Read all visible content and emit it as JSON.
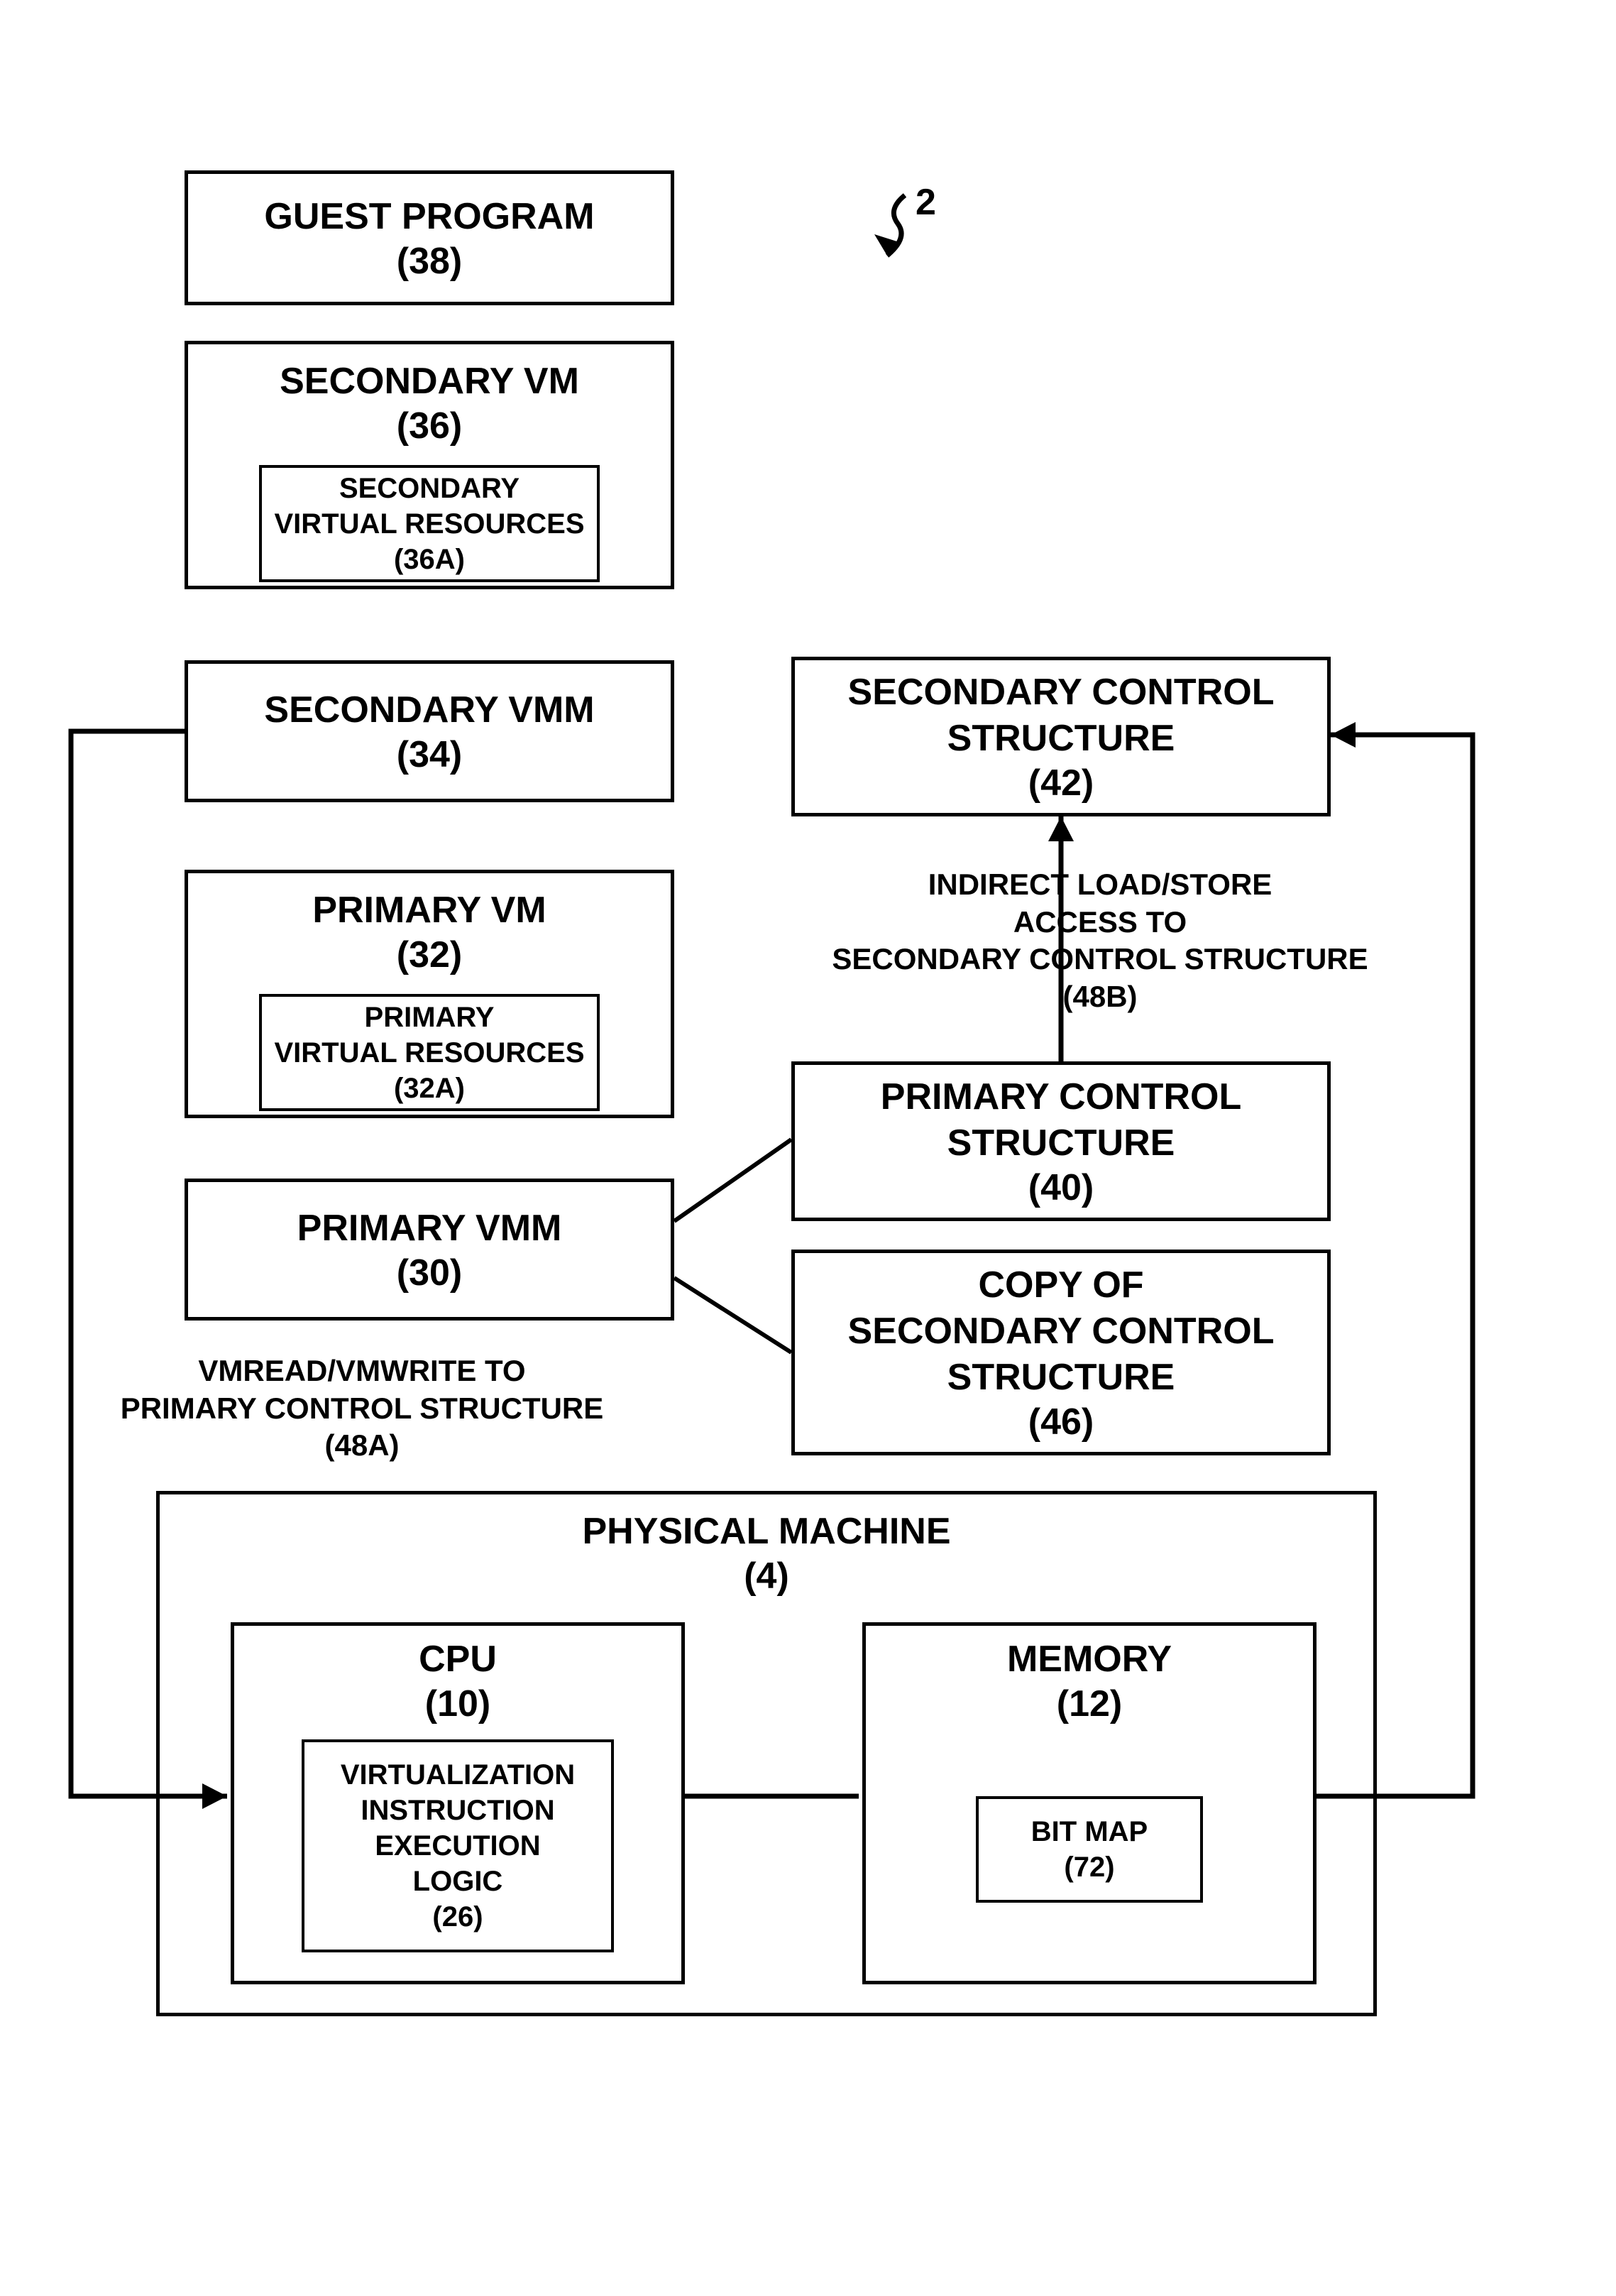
{
  "ref": {
    "two": "2"
  },
  "boxes": {
    "guest": {
      "title": "GUEST PROGRAM",
      "id": "(38)"
    },
    "secVM": {
      "title": "SECONDARY VM",
      "id": "(36)"
    },
    "secVR": {
      "title": "SECONDARY\nVIRTUAL RESOURCES",
      "id": "(36A)"
    },
    "secVMM": {
      "title": "SECONDARY VMM",
      "id": "(34)"
    },
    "priVM": {
      "title": "PRIMARY VM",
      "id": "(32)"
    },
    "priVR": {
      "title": "PRIMARY\nVIRTUAL RESOURCES",
      "id": "(32A)"
    },
    "priVMM": {
      "title": "PRIMARY VMM",
      "id": "(30)"
    },
    "secCS": {
      "title": "SECONDARY CONTROL\nSTRUCTURE",
      "id": "(42)"
    },
    "priCS": {
      "title": "PRIMARY CONTROL\nSTRUCTURE",
      "id": "(40)"
    },
    "copyCS": {
      "title": "COPY OF\nSECONDARY CONTROL\nSTRUCTURE",
      "id": "(46)"
    },
    "phys": {
      "title": "PHYSICAL MACHINE",
      "id": "(4)"
    },
    "cpu": {
      "title": "CPU",
      "id": "(10)"
    },
    "viel": {
      "title": "VIRTUALIZATION\nINSTRUCTION\nEXECUTION\nLOGIC",
      "id": "(26)"
    },
    "mem": {
      "title": "MEMORY",
      "id": "(12)"
    },
    "bitmap": {
      "title": "BIT MAP",
      "id": "(72)"
    }
  },
  "labels": {
    "vmrw": {
      "l1": "VMREAD/VMWRITE TO",
      "l2": "PRIMARY CONTROL STRUCTURE",
      "l3": "(48A)"
    },
    "indls": {
      "l1": "INDIRECT LOAD/STORE",
      "l2": "ACCESS TO",
      "l3": "SECONDARY CONTROL STRUCTURE",
      "l4": "(48B)"
    }
  }
}
